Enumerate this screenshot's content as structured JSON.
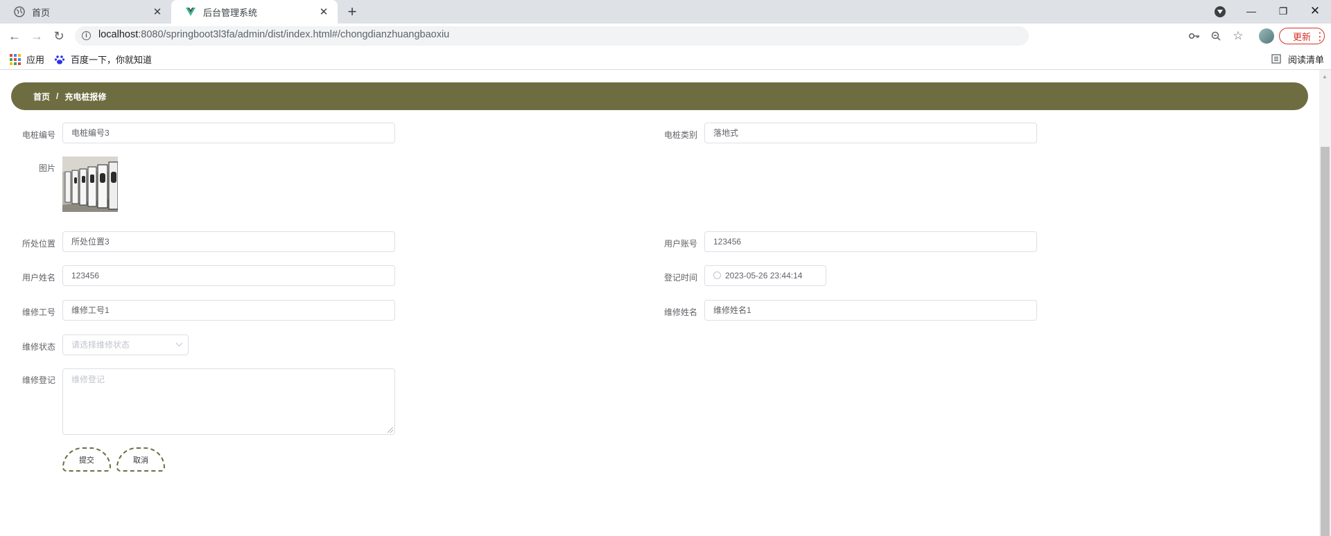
{
  "browser": {
    "tabs": [
      {
        "title": "首页",
        "icon": "globe-icon"
      },
      {
        "title": "后台管理系统",
        "icon": "vue-logo-icon"
      }
    ],
    "url_host": "localhost",
    "url_rest": ":8080/springboot3l3fa/admin/dist/index.html#/chongdianzhuangbaoxiu",
    "update_label": "更新",
    "bookmarks": [
      {
        "label": "应用",
        "icon": "apps-grid-icon"
      },
      {
        "label": "百度一下，你就知道",
        "icon": "baidu-paw-icon"
      }
    ],
    "reading_list_label": "阅读清单"
  },
  "breadcrumb": {
    "home": "首页",
    "separator": "/",
    "current": "充电桩报修"
  },
  "form": {
    "pile_no_label": "电桩编号",
    "pile_no_value": "电桩编号3",
    "pile_type_label": "电桩类别",
    "pile_type_value": "落地式",
    "image_label": "图片",
    "location_label": "所处位置",
    "location_value": "所处位置3",
    "user_account_label": "用户账号",
    "user_account_value": "123456",
    "user_name_label": "用户姓名",
    "user_name_value": "123456",
    "register_time_label": "登记时间",
    "register_time_value": "2023-05-26 23:44:14",
    "repair_id_label": "维修工号",
    "repair_id_value": "维修工号1",
    "repair_name_label": "维修姓名",
    "repair_name_value": "维修姓名1",
    "repair_status_label": "维修状态",
    "repair_status_placeholder": "请选择维修状态",
    "repair_record_label": "维修登记",
    "repair_record_placeholder": "维修登记",
    "submit_label": "提交",
    "cancel_label": "取消"
  },
  "colors": {
    "accent": "#6e6d41",
    "danger": "#d93025"
  }
}
